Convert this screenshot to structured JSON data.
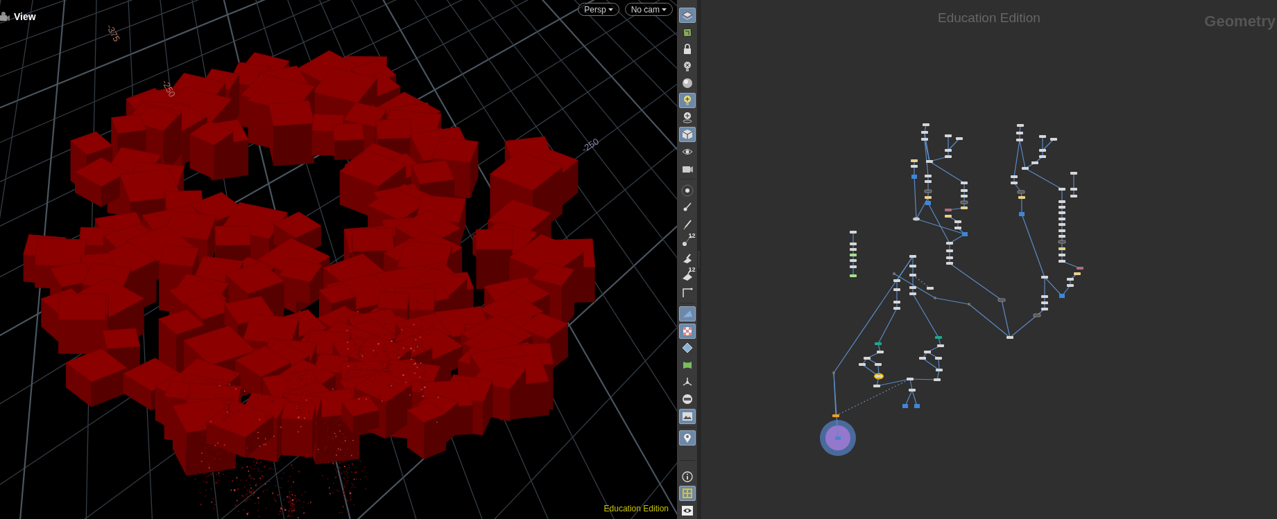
{
  "viewport": {
    "title": "View",
    "camera_menus": [
      {
        "label": "Persp"
      },
      {
        "label": "No cam"
      }
    ],
    "axis_labels": [
      {
        "text": "-375",
        "color": "#b07a6c"
      },
      {
        "text": "-250",
        "color": "#b07a6c"
      },
      {
        "text": "-250",
        "color": "#8a86b0"
      }
    ],
    "edition_label": "Education Edition"
  },
  "toolbar": {
    "groups": [
      [
        {
          "selected": true
        },
        {
          "selected": false
        },
        {
          "selected": false
        },
        {
          "selected": false
        },
        {
          "selected": false
        },
        {
          "selected": true
        },
        {
          "selected": false
        },
        {
          "selected": true
        },
        {
          "selected": false
        },
        {
          "selected": false
        }
      ],
      [
        {
          "selected": false
        },
        {
          "selected": false
        },
        {
          "selected": false
        },
        {
          "selected": false,
          "label": "12"
        },
        {
          "selected": false
        },
        {
          "selected": false,
          "label": "12"
        },
        {
          "selected": false
        }
      ],
      [
        {
          "selected": true
        },
        {
          "selected": true
        },
        {
          "selected": false
        },
        {
          "selected": false
        },
        {
          "selected": false
        },
        {
          "selected": false
        },
        {
          "selected": true
        }
      ],
      [
        {
          "selected": true
        }
      ],
      [
        {
          "selected": false
        },
        {
          "selected": true
        },
        {
          "selected": false
        }
      ]
    ]
  },
  "network": {
    "edition_label": "Education Edition",
    "context_label": "Geometry"
  }
}
